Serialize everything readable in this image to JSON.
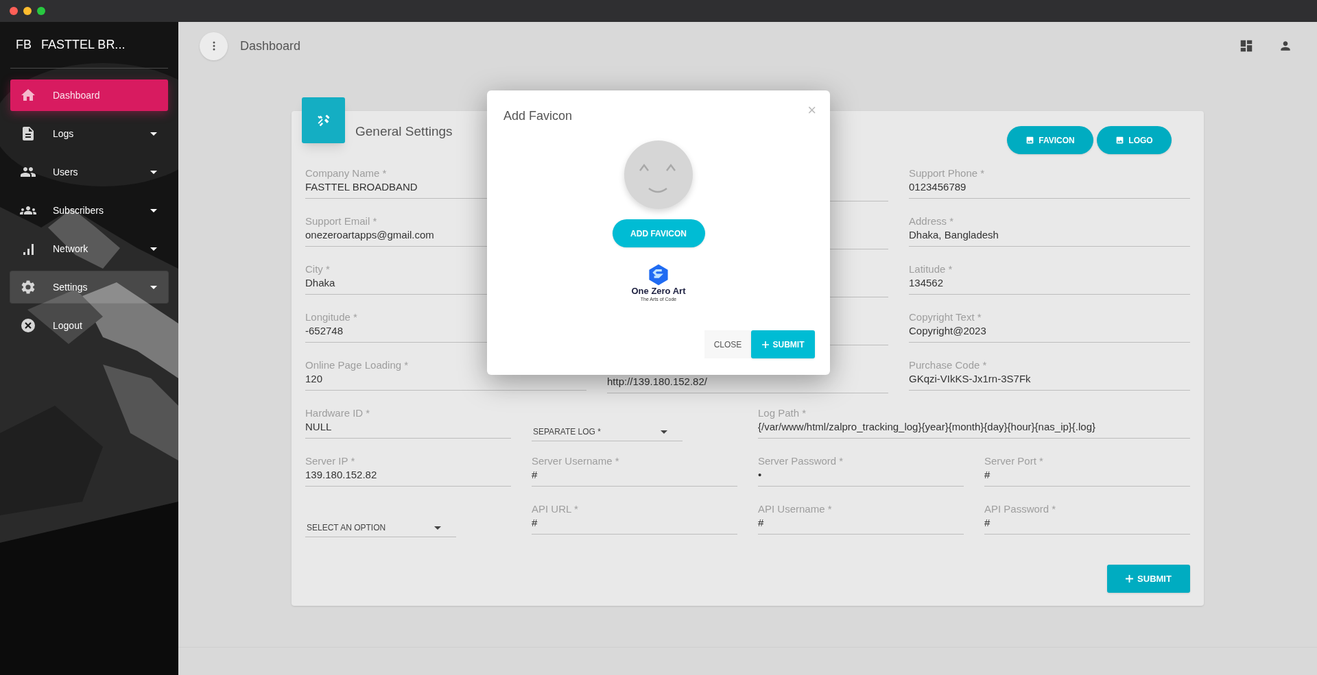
{
  "sidebar": {
    "brand_short": "FB",
    "brand_name": "FASTTEL BR...",
    "items": [
      {
        "label": "Dashboard",
        "selected": true,
        "highlighted": false,
        "has_submenu": false
      },
      {
        "label": "Logs",
        "selected": false,
        "highlighted": false,
        "has_submenu": true
      },
      {
        "label": "Users",
        "selected": false,
        "highlighted": false,
        "has_submenu": true
      },
      {
        "label": "Subscribers",
        "selected": false,
        "highlighted": false,
        "has_submenu": true
      },
      {
        "label": "Network",
        "selected": false,
        "highlighted": false,
        "has_submenu": true
      },
      {
        "label": "Settings",
        "selected": false,
        "highlighted": true,
        "has_submenu": true
      },
      {
        "label": "Logout",
        "selected": false,
        "highlighted": false,
        "has_submenu": false
      }
    ]
  },
  "header": {
    "title": "Dashboard"
  },
  "card": {
    "title": "General Settings",
    "buttons": [
      "FAVICON",
      "LOGO"
    ],
    "rows": [
      [
        {
          "kind": "field",
          "label": "Company Name *",
          "value": "FASTTEL BROADBAND"
        },
        {
          "kind": "covered"
        },
        {
          "kind": "field",
          "label": "Support Phone *",
          "value": "0123456789"
        }
      ],
      [
        {
          "kind": "field",
          "label": "Support Email *",
          "value": "onezeroartapps@gmail.com"
        },
        {
          "kind": "covered"
        },
        {
          "kind": "field",
          "label": "Address *",
          "value": "Dhaka, Bangladesh"
        }
      ],
      [
        {
          "kind": "field",
          "label": "City *",
          "value": "Dhaka"
        },
        {
          "kind": "covered"
        },
        {
          "kind": "field",
          "label": "Latitude *",
          "value": "134562"
        }
      ],
      [
        {
          "kind": "field",
          "label": "Longitude *",
          "value": "-652748"
        },
        {
          "kind": "covered"
        },
        {
          "kind": "field",
          "label": "Copyright Text *",
          "value": "Copyright@2023"
        }
      ],
      [
        {
          "kind": "field",
          "label": "Online Page Loading *",
          "value": "120"
        },
        {
          "kind": "value_only",
          "value": "http://139.180.152.82/"
        },
        {
          "kind": "field",
          "label": "Purchase Code *",
          "value": "GKqzi-VIkKS-Jx1rn-3S7Fk"
        }
      ]
    ],
    "rows4": [
      [
        {
          "kind": "field",
          "label": "Hardware ID *",
          "value": "NULL"
        },
        {
          "kind": "select",
          "value": "SEPARATE LOG *"
        },
        {
          "kind": "wide",
          "label": "Log Path *",
          "value": "{/var/www/html/zalpro_tracking_log}{year}{month}{day}{hour}{nas_ip}{.log}"
        }
      ],
      [
        {
          "kind": "field",
          "label": "Server IP *",
          "value": "139.180.152.82"
        },
        {
          "kind": "field",
          "label": "Server Username *",
          "value": "#"
        },
        {
          "kind": "field",
          "label": "Server Password *",
          "value": "•"
        },
        {
          "kind": "field",
          "label": "Server Port *",
          "value": "#"
        }
      ],
      [
        {
          "kind": "select",
          "value": "SELECT AN OPTION"
        },
        {
          "kind": "field",
          "label": "API URL *",
          "value": "#"
        },
        {
          "kind": "field",
          "label": "API Username *",
          "value": "#"
        },
        {
          "kind": "field",
          "label": "API Password *",
          "value": "#"
        }
      ]
    ],
    "submit": "SUBMIT"
  },
  "modal": {
    "title": "Add Favicon",
    "close_icon": "×",
    "upload_button": "ADD FAVICON",
    "logo_name": "One Zero Art",
    "logo_tagline": "The Arts of Code",
    "buttons": [
      "CLOSE",
      "SUBMIT"
    ]
  }
}
